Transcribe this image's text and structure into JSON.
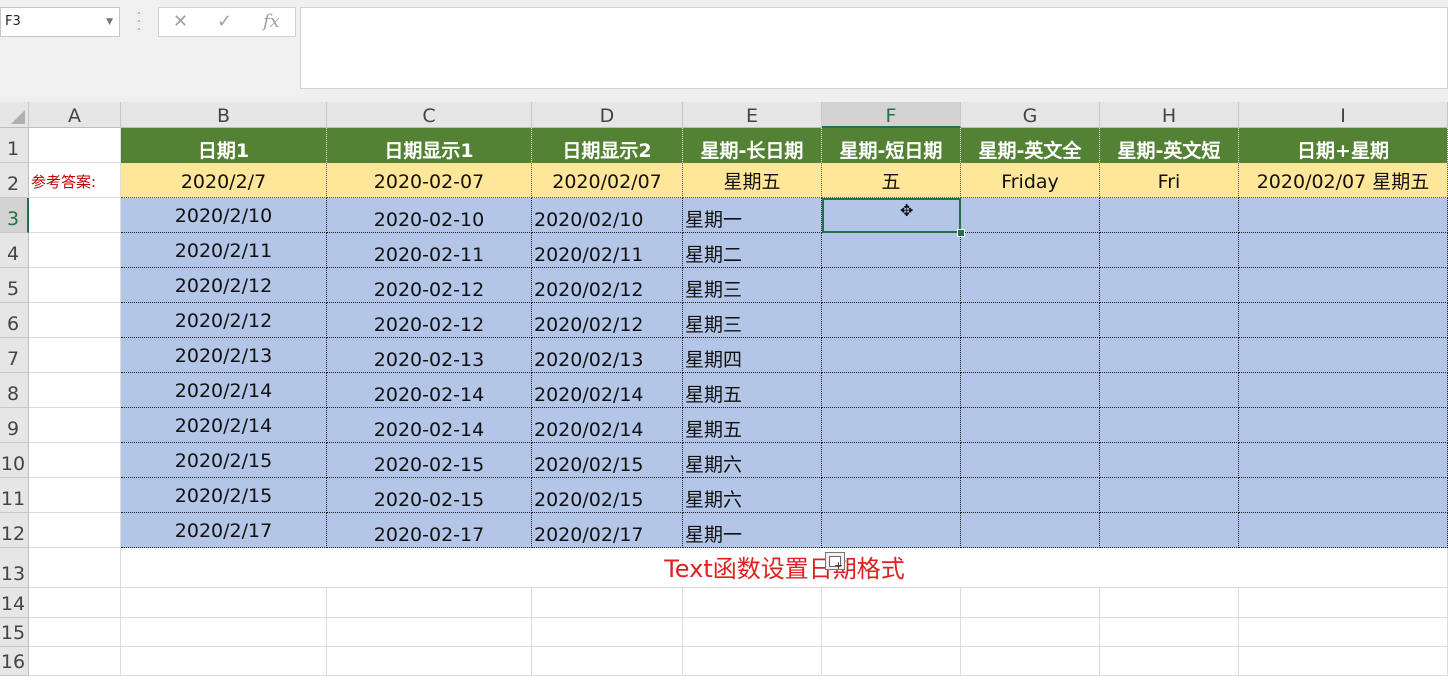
{
  "name_box": {
    "value": "F3"
  },
  "formula_bar": {
    "cancel_symbol": "✕",
    "enter_symbol": "✓",
    "fx_symbol": "fx",
    "formula": ""
  },
  "columns": [
    "A",
    "B",
    "C",
    "D",
    "E",
    "F",
    "G",
    "H",
    "I"
  ],
  "selected_column": "F",
  "rows": [
    "1",
    "2",
    "3",
    "4",
    "5",
    "6",
    "7",
    "8",
    "9",
    "10",
    "11",
    "12",
    "13",
    "14",
    "15",
    "16"
  ],
  "selected_row": "3",
  "headers": [
    "日期1",
    "日期显示1",
    "日期显示2",
    "星期-长日期",
    "星期-短日期",
    "星期-英文全",
    "星期-英文短",
    "日期+星期"
  ],
  "answer_label": "参考答案:",
  "answers": [
    "2020/2/7",
    "2020-02-07",
    "2020/02/07",
    "星期五",
    "五",
    "Friday",
    "Fri",
    "2020/02/07 星期五"
  ],
  "data_rows": [
    [
      "2020/2/10",
      "2020-02-10",
      "2020/02/10",
      "星期一"
    ],
    [
      "2020/2/11",
      "2020-02-11",
      "2020/02/11",
      "星期二"
    ],
    [
      "2020/2/12",
      "2020-02-12",
      "2020/02/12",
      "星期三"
    ],
    [
      "2020/2/12",
      "2020-02-12",
      "2020/02/12",
      "星期三"
    ],
    [
      "2020/2/13",
      "2020-02-13",
      "2020/02/13",
      "星期四"
    ],
    [
      "2020/2/14",
      "2020-02-14",
      "2020/02/14",
      "星期五"
    ],
    [
      "2020/2/14",
      "2020-02-14",
      "2020/02/14",
      "星期五"
    ],
    [
      "2020/2/15",
      "2020-02-15",
      "2020/02/15",
      "星期六"
    ],
    [
      "2020/2/15",
      "2020-02-15",
      "2020/02/15",
      "星期六"
    ],
    [
      "2020/2/17",
      "2020-02-17",
      "2020/02/17",
      "星期一"
    ]
  ],
  "caption": "Text函数设置日期格式",
  "colors": {
    "header_green": "#548235",
    "answer_yellow": "#ffe699",
    "data_blue": "#b4c6e7",
    "caption_red": "#e02020",
    "select_green": "#217346"
  },
  "icons": {
    "cursor": "cell-cursor-icon",
    "paste_options": "paste-options-icon"
  }
}
